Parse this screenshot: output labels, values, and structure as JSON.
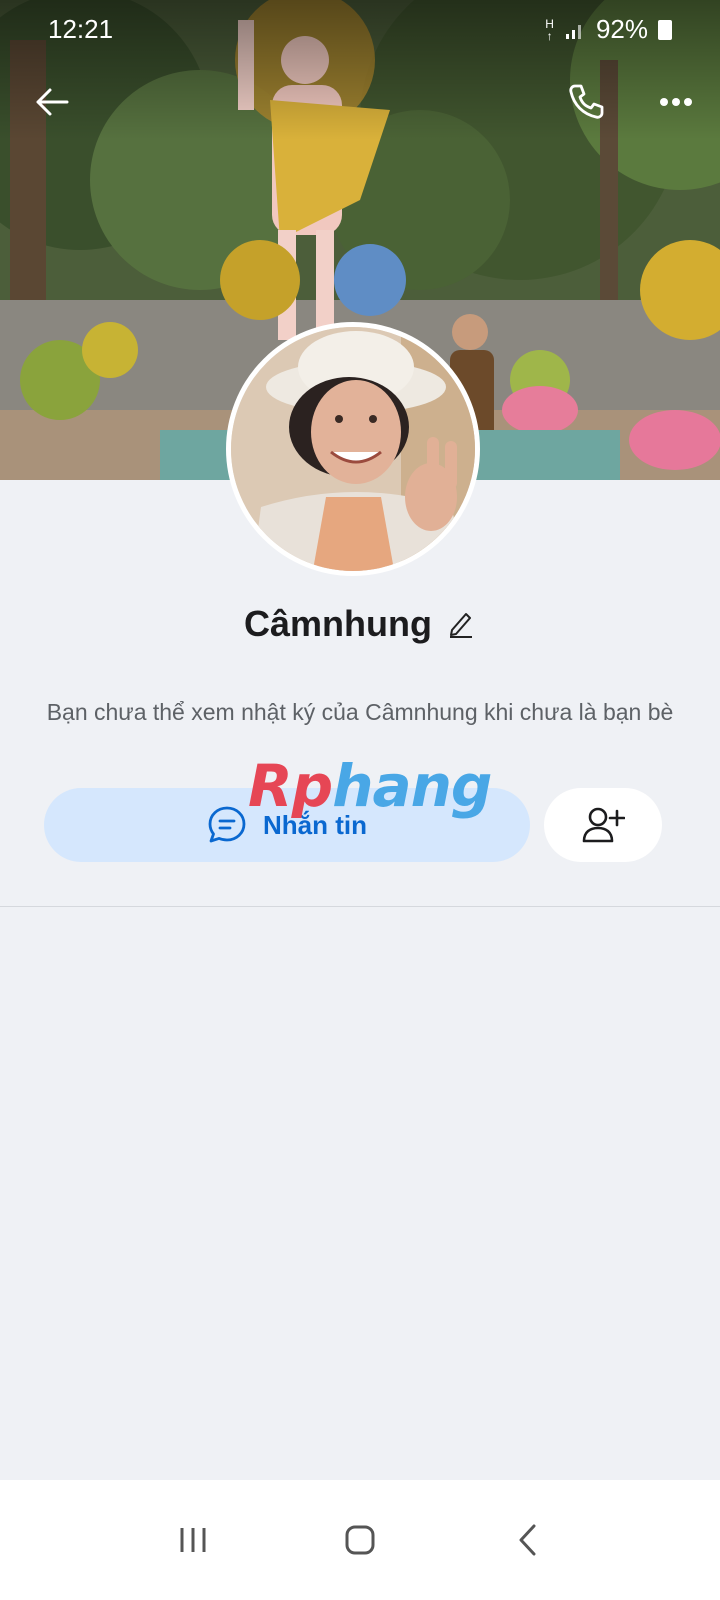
{
  "status_bar": {
    "time": "12:21",
    "network": "H",
    "battery": "92%",
    "icons": [
      "network-h-icon",
      "signal-icon",
      "battery-icon"
    ]
  },
  "header": {
    "back_icon": "arrow-left-icon",
    "call_icon": "phone-icon",
    "more_icon": "more-dots-icon"
  },
  "profile": {
    "name": "Câmnhung",
    "edit_icon": "pencil-icon",
    "notice": "Bạn chưa thể xem nhật ký của Câmnhung khi chưa là bạn bè"
  },
  "actions": {
    "message_label": "Nhắn tin",
    "message_icon": "chat-bubble-icon",
    "add_friend_icon": "add-user-icon"
  },
  "watermark": {
    "part_a": "Rp",
    "part_b": "hang"
  },
  "nav": {
    "recents_icon": "recents-icon",
    "home_icon": "home-icon",
    "back_icon": "back-chevron-icon"
  },
  "colors": {
    "accent": "#0a68d0",
    "accent_bg": "#d5e7fd",
    "background": "#eff1f5"
  }
}
